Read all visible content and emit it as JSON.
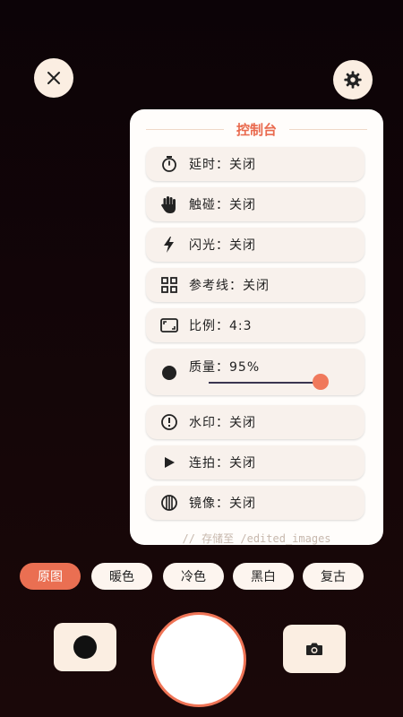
{
  "panel": {
    "title": "控制台",
    "rows": [
      {
        "label": "延时：关闭",
        "icon": "timer-icon"
      },
      {
        "label": "触碰：关闭",
        "icon": "hand-icon"
      },
      {
        "label": "闪光：关闭",
        "icon": "flash-icon"
      },
      {
        "label": "参考线：关闭",
        "icon": "grid-icon"
      },
      {
        "label": "比例：4:3",
        "icon": "aspect-ratio-icon"
      },
      {
        "label": "质量：95%",
        "icon": "quality-dot-icon",
        "slider_value": 0.95
      },
      {
        "label": "水印：关闭",
        "icon": "watermark-icon"
      },
      {
        "label": "连拍：关闭",
        "icon": "play-icon"
      },
      {
        "label": "镜像：关闭",
        "icon": "mirror-icon"
      }
    ],
    "footer": "// 存储至 /edited_images"
  },
  "filters": [
    {
      "label": "原图",
      "active": true
    },
    {
      "label": "暖色",
      "active": false
    },
    {
      "label": "冷色",
      "active": false
    },
    {
      "label": "黑白",
      "active": false
    },
    {
      "label": "复古",
      "active": false
    }
  ],
  "icons": {
    "close": "close-icon",
    "settings": "gear-icon",
    "record": "record-dot-icon",
    "camera": "camera-icon"
  },
  "colors": {
    "accent": "#ea6f52",
    "background": "#0f0508",
    "panel": "#fffdfb",
    "chip": "#fdf5ef"
  }
}
